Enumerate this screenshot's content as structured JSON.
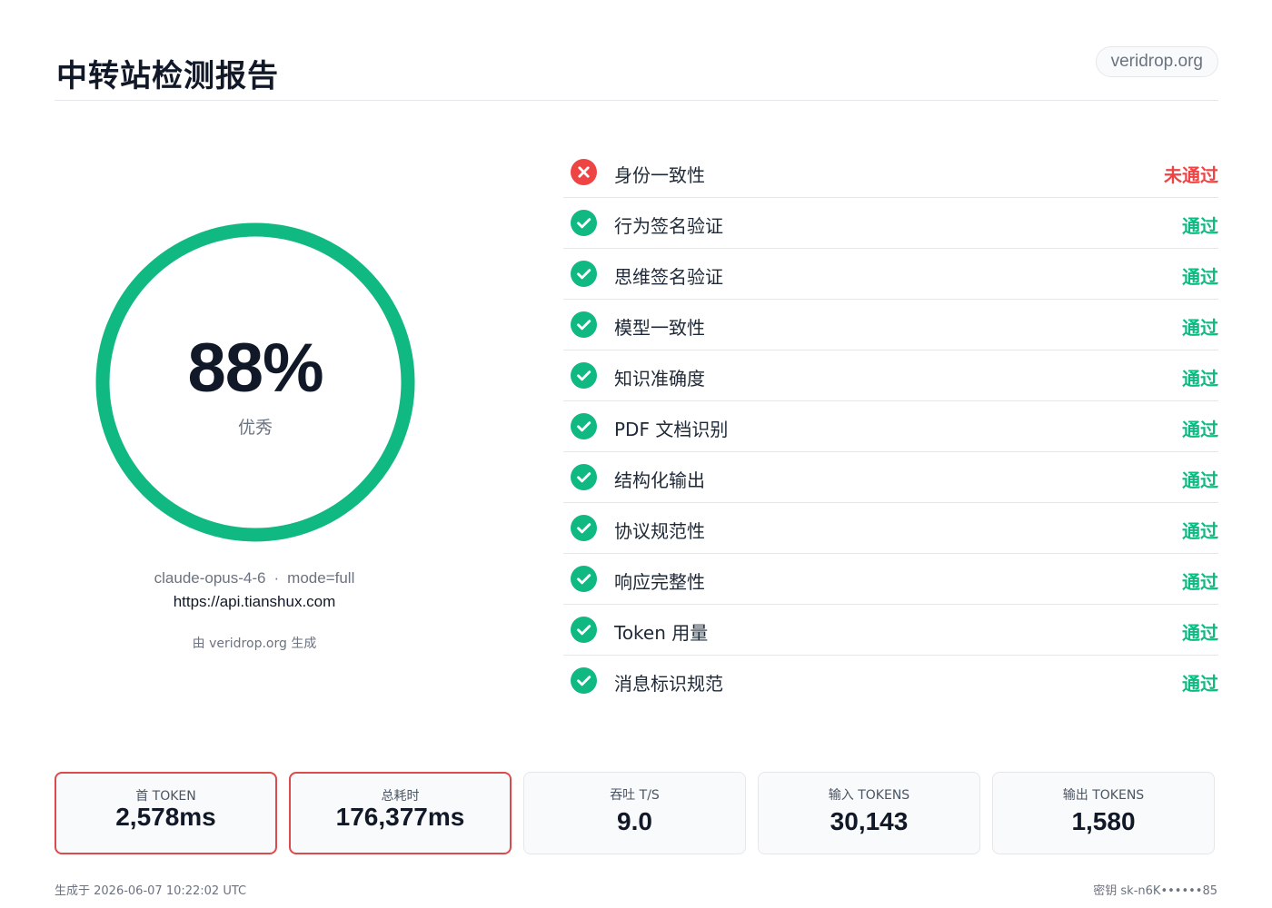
{
  "header": {
    "title": "中转站检测报告",
    "domain": "veridrop.org"
  },
  "score": {
    "value": "88%",
    "percent": 88,
    "label": "优秀",
    "ring_color": "#10b981"
  },
  "info": {
    "model": "claude-opus-4-6",
    "separator": "·",
    "mode": "mode=full",
    "url": "https://api.tianshux.com",
    "generated_by": "由 veridrop.org 生成"
  },
  "checks": [
    {
      "name": "身份一致性",
      "status": "未通过",
      "result": "fail",
      "icon": "x-circle-icon"
    },
    {
      "name": "行为签名验证",
      "status": "通过",
      "result": "pass",
      "icon": "check-circle-icon"
    },
    {
      "name": "思维签名验证",
      "status": "通过",
      "result": "pass",
      "icon": "check-circle-icon"
    },
    {
      "name": "模型一致性",
      "status": "通过",
      "result": "pass",
      "icon": "check-circle-icon"
    },
    {
      "name": "知识准确度",
      "status": "通过",
      "result": "pass",
      "icon": "check-circle-icon"
    },
    {
      "name": "PDF 文档识别",
      "status": "通过",
      "result": "pass",
      "icon": "check-circle-icon"
    },
    {
      "name": "结构化输出",
      "status": "通过",
      "result": "pass",
      "icon": "check-circle-icon"
    },
    {
      "name": "协议规范性",
      "status": "通过",
      "result": "pass",
      "icon": "check-circle-icon"
    },
    {
      "name": "响应完整性",
      "status": "通过",
      "result": "pass",
      "icon": "check-circle-icon"
    },
    {
      "name": "Token 用量",
      "status": "通过",
      "result": "pass",
      "icon": "check-circle-icon"
    },
    {
      "name": "消息标识规范",
      "status": "通过",
      "result": "pass",
      "icon": "check-circle-icon"
    }
  ],
  "metrics": [
    {
      "label": "首 TOKEN",
      "value": "2,578ms",
      "alert": true
    },
    {
      "label": "总耗时",
      "value": "176,377ms",
      "alert": true
    },
    {
      "label": "吞吐 T/S",
      "value": "9.0",
      "alert": false
    },
    {
      "label": "输入 TOKENS",
      "value": "30,143",
      "alert": false
    },
    {
      "label": "输出 TOKENS",
      "value": "1,580",
      "alert": false
    }
  ],
  "footer": {
    "generated_at": "生成于 2026-06-07 10:22:02 UTC",
    "key": "密钥 sk-n6K••••••85"
  },
  "colors": {
    "pass": "#10b981",
    "fail": "#ef4444",
    "alert_border": "#dc4b4b"
  }
}
